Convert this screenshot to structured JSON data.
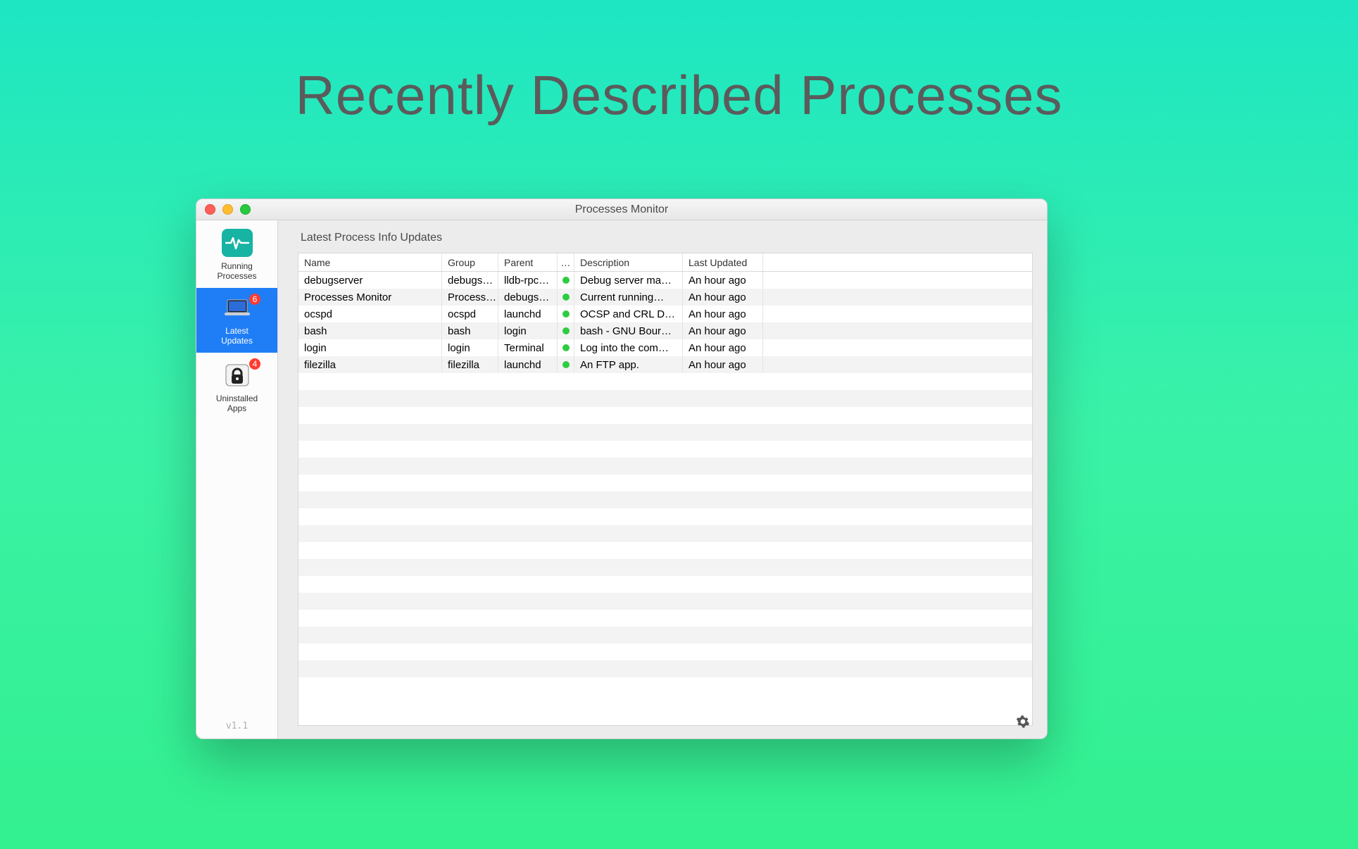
{
  "hero": {
    "title": "Recently Described Processes"
  },
  "window": {
    "title": "Processes Monitor"
  },
  "sidebar": {
    "items": [
      {
        "label": "Running\nProcesses",
        "badge": null
      },
      {
        "label": "Latest\nUpdates",
        "badge": "6"
      },
      {
        "label": "Uninstalled\nApps",
        "badge": "4"
      }
    ],
    "version": "v1.1"
  },
  "main": {
    "section_title": "Latest Process Info Updates",
    "columns": {
      "name": "Name",
      "group": "Group",
      "parent": "Parent",
      "status": "…",
      "description": "Description",
      "updated": "Last Updated"
    },
    "rows": [
      {
        "name": "debugserver",
        "group": "debugs…",
        "parent": "lldb-rpc…",
        "desc": "Debug server ma…",
        "updated": "An hour ago"
      },
      {
        "name": "Processes Monitor",
        "group": "Process…",
        "parent": "debugs…",
        "desc": "Current running…",
        "updated": "An hour ago"
      },
      {
        "name": "ocspd",
        "group": "ocspd",
        "parent": "launchd",
        "desc": "OCSP and CRL D…",
        "updated": "An hour ago"
      },
      {
        "name": "bash",
        "group": "bash",
        "parent": "login",
        "desc": "bash - GNU Bour…",
        "updated": "An hour ago"
      },
      {
        "name": "login",
        "group": "login",
        "parent": "Terminal",
        "desc": "Log into the com…",
        "updated": "An hour ago"
      },
      {
        "name": "filezilla",
        "group": "filezilla",
        "parent": "launchd",
        "desc": "An FTP app.",
        "updated": "An hour ago"
      }
    ],
    "empty_rows": 18
  }
}
